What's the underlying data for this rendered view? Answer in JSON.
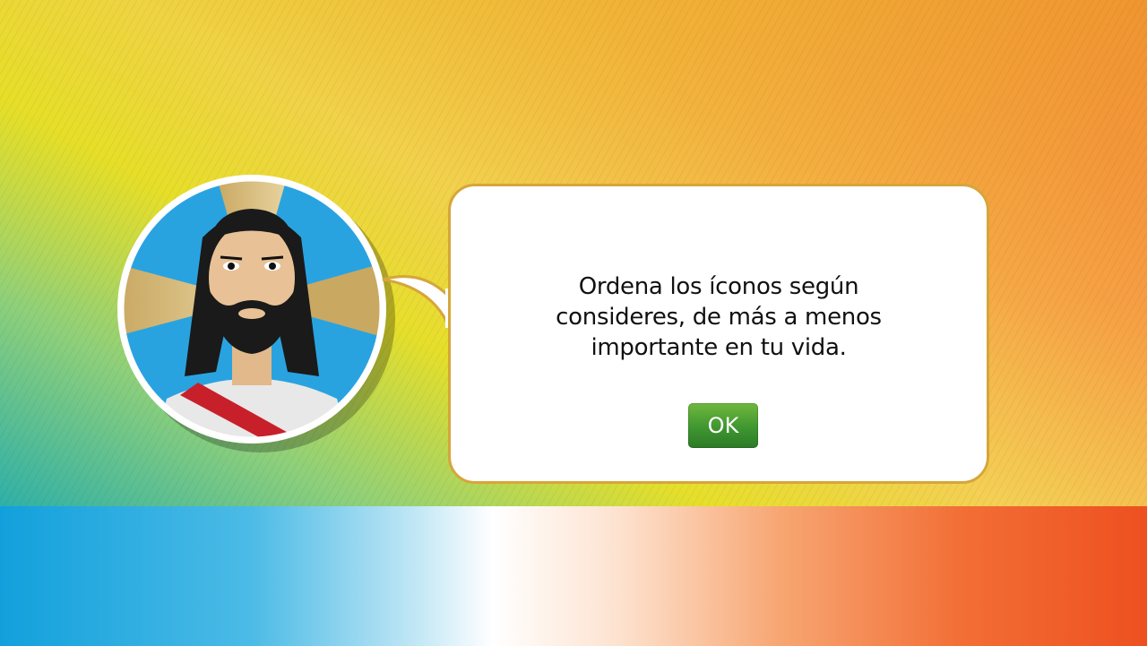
{
  "dialog": {
    "message_line1": "Ordena los íconos según",
    "message_line2": "consideres, de más a menos",
    "message_line3": "importante en tu vida.",
    "ok_label": "OK"
  },
  "avatar": {
    "icon": "jesus-avatar-icon"
  },
  "colors": {
    "bubble_border": "#d6a63a",
    "ok_button": "#3f9630",
    "avatar_background": "#29a3e0",
    "sash": "#c8202a"
  }
}
